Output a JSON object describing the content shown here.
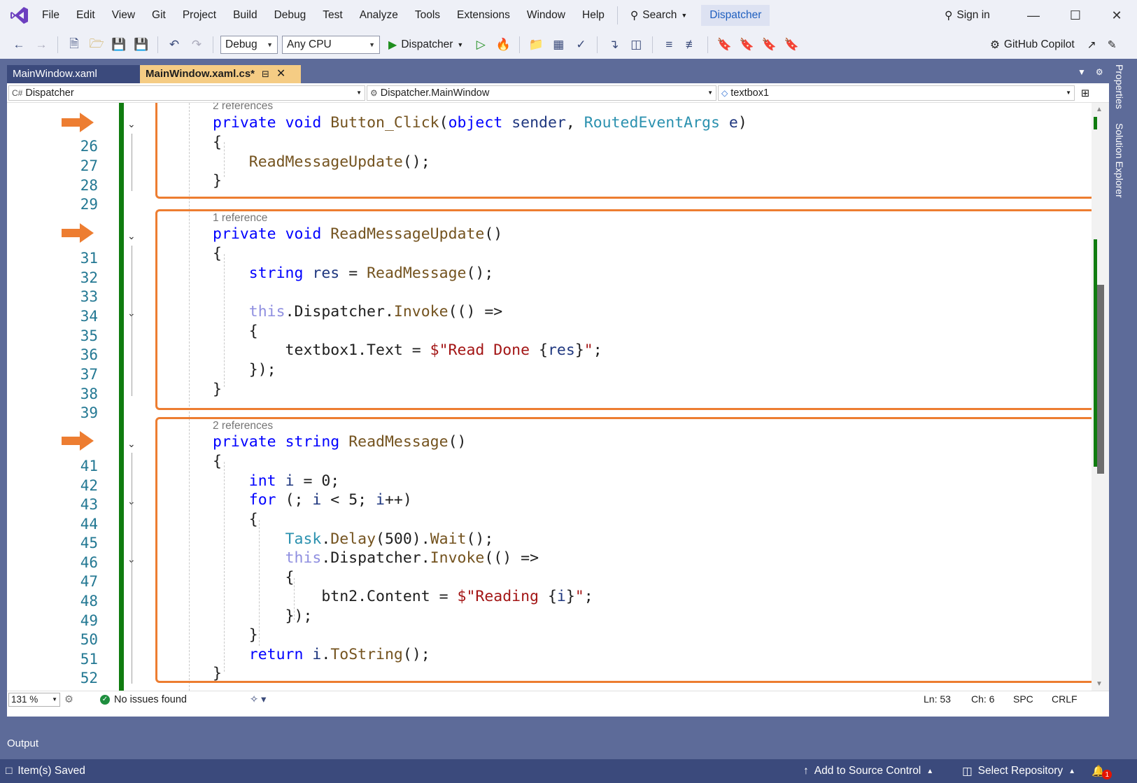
{
  "menu": {
    "items": [
      "File",
      "Edit",
      "View",
      "Git",
      "Project",
      "Build",
      "Debug",
      "Test",
      "Analyze",
      "Tools",
      "Extensions",
      "Window",
      "Help"
    ],
    "search_label": "Search",
    "solution_name": "Dispatcher",
    "sign_in": "Sign in"
  },
  "toolbar": {
    "configuration": "Debug",
    "platform": "Any CPU",
    "startup_project": "Dispatcher",
    "copilot_label": "GitHub Copilot"
  },
  "tabs": [
    {
      "label": "MainWindow.xaml",
      "active": false
    },
    {
      "label": "MainWindow.xaml.cs*",
      "active": true
    }
  ],
  "nav": {
    "project": "Dispatcher",
    "type": "Dispatcher.MainWindow",
    "member": "textbox1"
  },
  "line_numbers": [
    "26",
    "27",
    "28",
    "29",
    "31",
    "32",
    "33",
    "34",
    "35",
    "36",
    "37",
    "38",
    "39",
    "41",
    "42",
    "43",
    "44",
    "45",
    "46",
    "47",
    "48",
    "49",
    "50",
    "51",
    "52"
  ],
  "code": {
    "block1_refs": "2 references",
    "block2_refs": "1 reference",
    "block3_refs": "2 references"
  },
  "status": {
    "zoom": "131 %",
    "issues": "No issues found",
    "ln": "Ln: 53",
    "ch": "Ch: 6",
    "spc": "SPC",
    "crlf": "CRLF"
  },
  "output_title": "Output",
  "statusbar": {
    "saved": "Item(s) Saved",
    "add_source_control": "Add to Source Control",
    "select_repository": "Select Repository",
    "notifications": "1"
  },
  "side_panels": [
    "Properties",
    "Solution Explorer"
  ],
  "colors": {
    "accent": "#ed7d31",
    "keyword": "#0000ff",
    "type": "#2b91af",
    "method": "#74531f",
    "string": "#a31515",
    "change_bar": "#107c10"
  }
}
